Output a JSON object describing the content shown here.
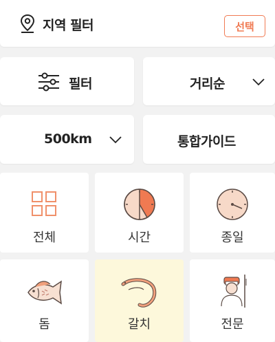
{
  "region": {
    "title": "지역 필터",
    "select_label": "선택"
  },
  "filter": {
    "label": "필터"
  },
  "sort": {
    "label": "거리순"
  },
  "distance": {
    "label": "500km"
  },
  "guide": {
    "label": "통합가이드"
  },
  "categories": [
    {
      "label": "전체",
      "icon": "grid-icon"
    },
    {
      "label": "시간",
      "icon": "clock-pie-icon"
    },
    {
      "label": "종일",
      "icon": "clock-icon"
    },
    {
      "label": "돔",
      "icon": "fish-icon"
    },
    {
      "label": "갈치",
      "icon": "eel-icon",
      "selected": true
    },
    {
      "label": "전문",
      "icon": "angler-icon"
    }
  ],
  "colors": {
    "accent": "#f07a52",
    "selected_bg": "#fdf8db",
    "page_bg": "#f2f2f2"
  }
}
